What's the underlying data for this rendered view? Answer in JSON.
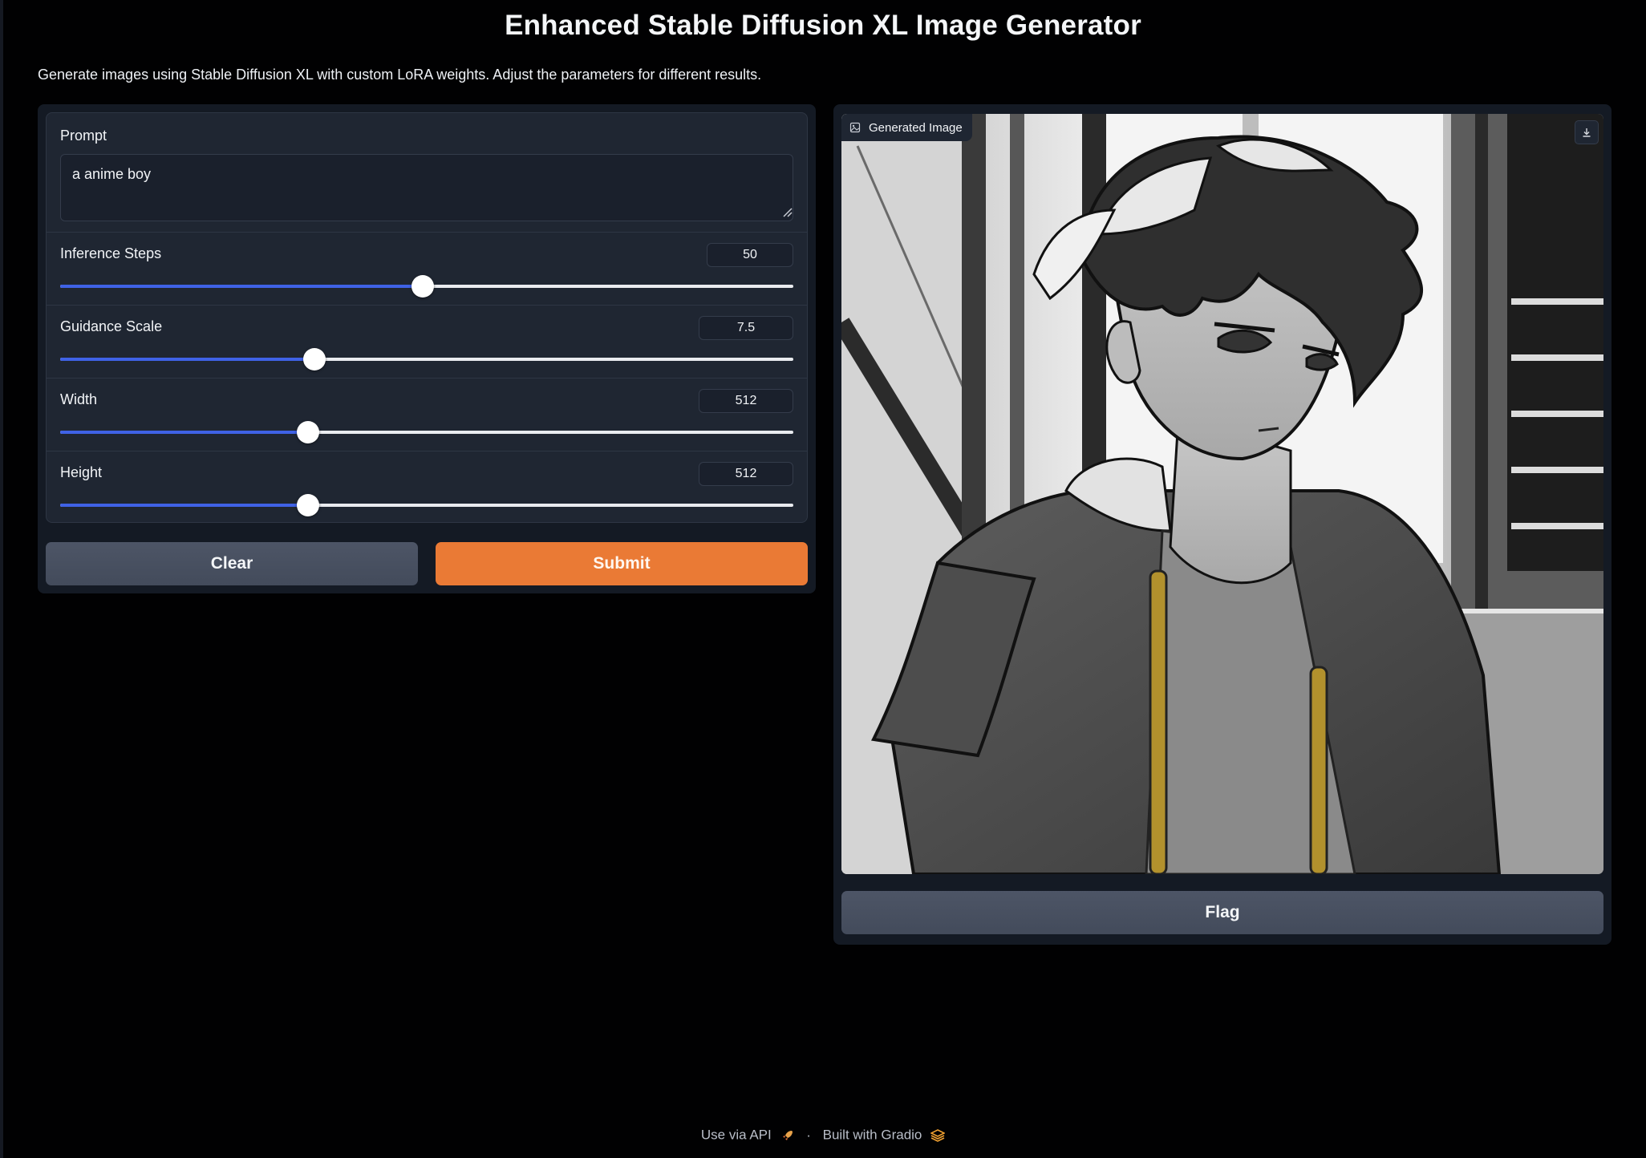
{
  "header": {
    "title": "Enhanced Stable Diffusion XL Image Generator",
    "description": "Generate images using Stable Diffusion XL with custom LoRA weights. Adjust the parameters for different results."
  },
  "prompt": {
    "label": "Prompt",
    "value": "a anime boy"
  },
  "sliders": {
    "inference_steps": {
      "label": "Inference Steps",
      "value": "50",
      "fraction": 0.495
    },
    "guidance_scale": {
      "label": "Guidance Scale",
      "value": "7.5",
      "fraction": 0.347
    },
    "width": {
      "label": "Width",
      "value": "512",
      "fraction": 0.338
    },
    "height": {
      "label": "Height",
      "value": "512",
      "fraction": 0.338
    }
  },
  "buttons": {
    "clear": "Clear",
    "submit": "Submit",
    "flag": "Flag"
  },
  "output": {
    "label": "Generated Image",
    "icon": "image-icon",
    "download_icon": "download-icon"
  },
  "footer": {
    "api_link": "Use via API",
    "separator": "·",
    "built_with": "Built with Gradio"
  },
  "colors": {
    "accent": "#ea7a35",
    "slider": "#3f62e6",
    "panel": "#141a24"
  }
}
